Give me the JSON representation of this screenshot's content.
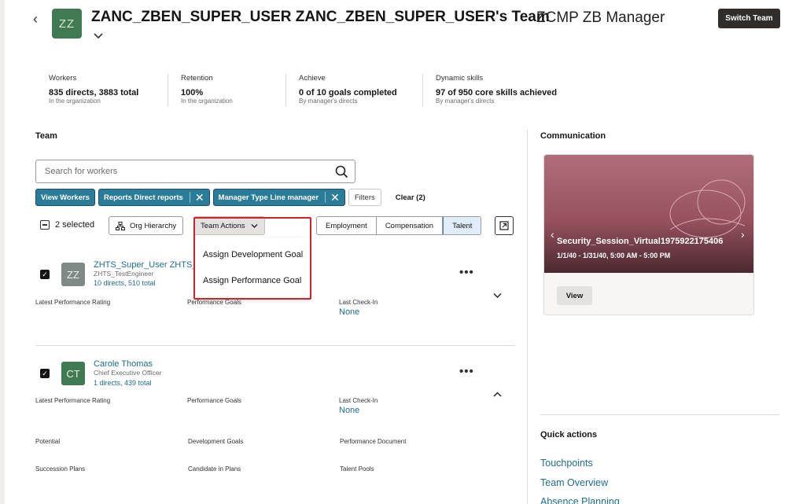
{
  "header": {
    "avatar_initials": "ZZ",
    "title": "ZANC_ZBEN_SUPER_USER ZANC_ZBEN_SUPER_USER's Team",
    "subtitle": "ZCMP ZB Manager",
    "switch_team_label": "Switch Team"
  },
  "stats": [
    {
      "label": "Workers",
      "value": "835 directs, 3883 total",
      "sub": "In the organization"
    },
    {
      "label": "Retention",
      "value": "100%",
      "sub": "In the organization"
    },
    {
      "label": "Achieve",
      "value": "0 of 10 goals completed",
      "sub": "By manager's directs"
    },
    {
      "label": "Dynamic skills",
      "value": "97 of 950 core skills achieved",
      "sub": "By manager's directs"
    }
  ],
  "team": {
    "title": "Team",
    "search_placeholder": "Search for workers",
    "chips": [
      "View Workers",
      "Reports Direct reports",
      "Manager Type Line manager"
    ],
    "filters_label": "Filters",
    "clear_label": "Clear (2)",
    "selected_label": "2 selected",
    "org_hierarchy_label": "Org Hierarchy",
    "team_actions_label": "Team Actions",
    "segments": [
      "Employment",
      "Compensation",
      "Talent"
    ],
    "active_segment": "Talent",
    "menu_items": [
      "Assign Development Goal",
      "Assign Performance Goal"
    ]
  },
  "workers": [
    {
      "initials": "ZZ",
      "name": "ZHTS_Super_User ZHTS_",
      "job": "ZHTS_TestEngineer",
      "directs": "10 directs, 510 total",
      "fields": {
        "latest_rating_label": "Latest Performance Rating",
        "perf_goals_label": "Performance Goals",
        "last_checkin_label": "Last Check-In",
        "last_checkin_value": "None"
      }
    },
    {
      "initials": "CT",
      "name": "Carole Thomas",
      "job": "Chief Executive Officer",
      "directs": "1 directs, 439 total",
      "fields": {
        "latest_rating_label": "Latest Performance Rating",
        "perf_goals_label": "Performance Goals",
        "last_checkin_label": "Last Check-In",
        "last_checkin_value": "None",
        "potential_label": "Potential",
        "dev_goals_label": "Development Goals",
        "perf_doc_label": "Performance Document",
        "succession_label": "Succession Plans",
        "candidate_label": "Candidate in Plans",
        "talent_pools_label": "Talent Pools"
      }
    }
  ],
  "communication": {
    "title": "Communication",
    "card_title": "Security_Session_Virtual1975922175406",
    "card_date": "1/1/40 - 1/31/40, 5:00 AM - 5:00 PM",
    "view_label": "View"
  },
  "quick_actions": {
    "title": "Quick actions",
    "links": [
      "Touchpoints",
      "Team Overview",
      "Absence Planning"
    ]
  },
  "colors": {
    "accent_chip": "#2a7c99",
    "link": "#1f6e8c",
    "highlight_border": "#d3212b",
    "switch_button": "#312d2a"
  }
}
